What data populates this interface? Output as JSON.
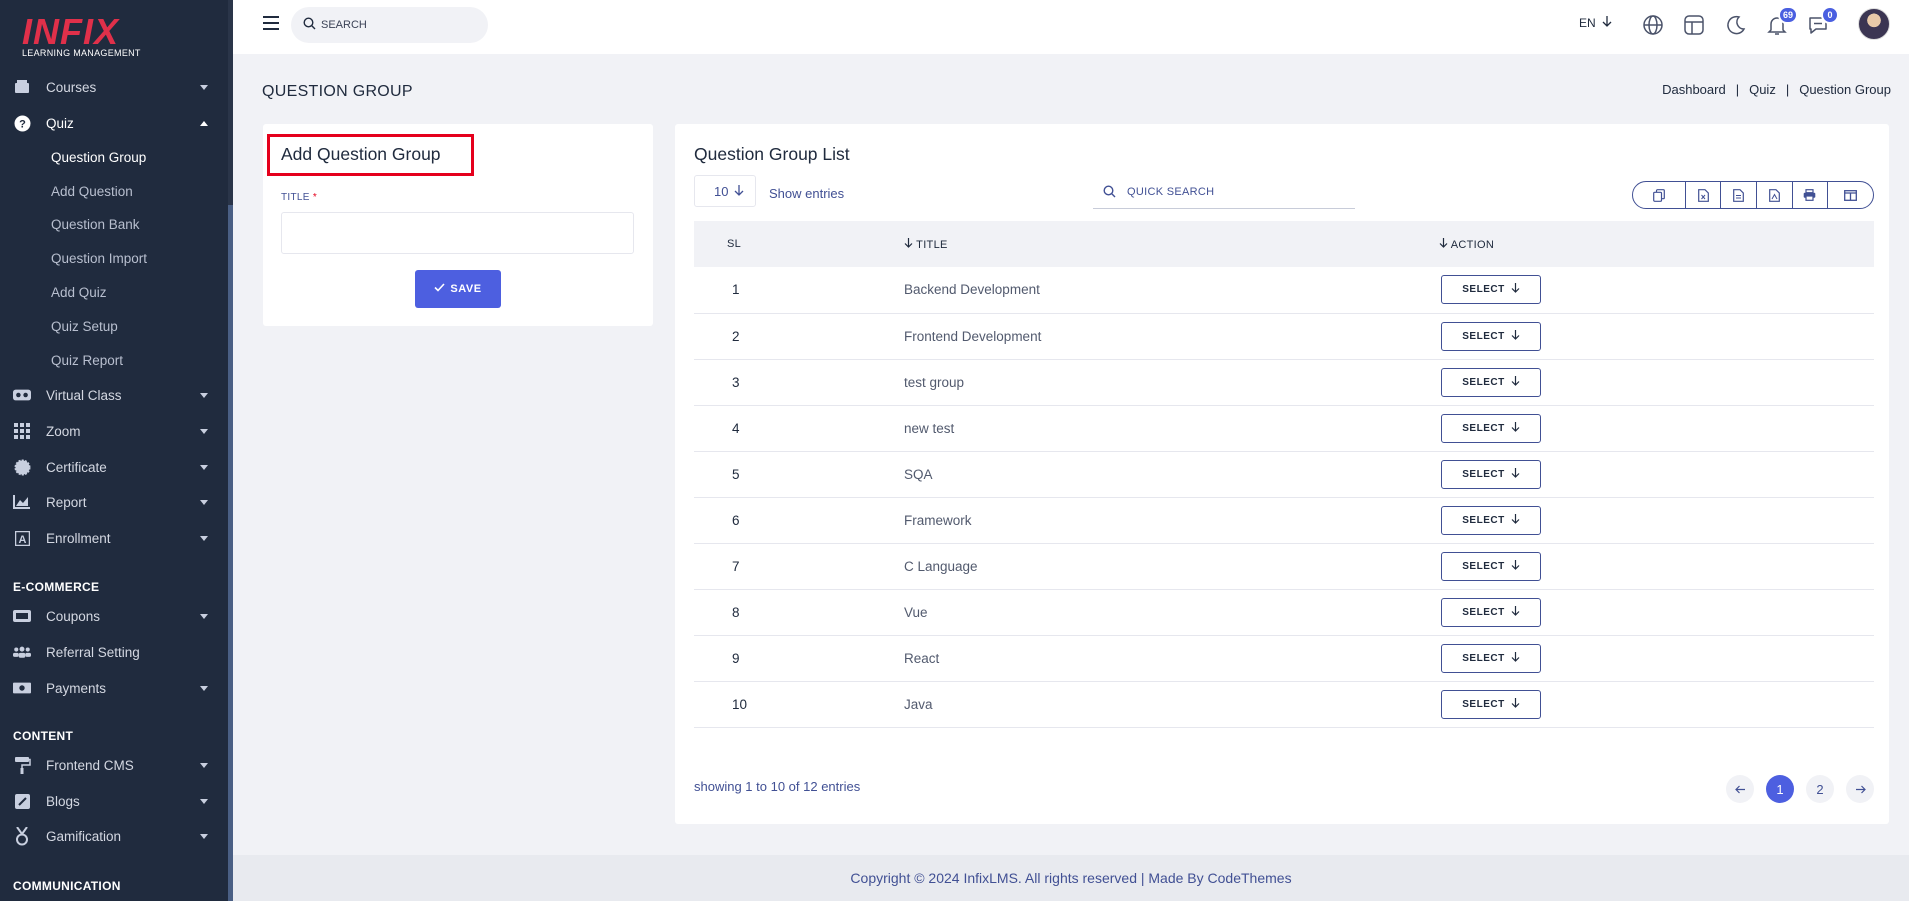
{
  "brand": {
    "name": "INFIX",
    "tagline": "LEARNING MANAGEMENT"
  },
  "sidebar": {
    "items": [
      {
        "label": "Courses",
        "icon": "book-icon"
      },
      {
        "label": "Quiz",
        "icon": "question-circle-icon"
      },
      {
        "label": "Virtual Class",
        "icon": "vr-icon"
      },
      {
        "label": "Zoom",
        "icon": "grid-icon"
      },
      {
        "label": "Certificate",
        "icon": "certificate-icon"
      },
      {
        "label": "Report",
        "icon": "chart-icon"
      },
      {
        "label": "Enrollment",
        "icon": "enrollment-icon"
      },
      {
        "label": "Coupons",
        "icon": "coupon-icon"
      },
      {
        "label": "Referral Setting",
        "icon": "users-icon"
      },
      {
        "label": "Payments",
        "icon": "money-icon"
      },
      {
        "label": "Frontend CMS",
        "icon": "paint-roller-icon"
      },
      {
        "label": "Blogs",
        "icon": "edit-icon"
      },
      {
        "label": "Gamification",
        "icon": "medal-icon"
      }
    ],
    "quiz_sub": [
      "Question Group",
      "Add Question",
      "Question Bank",
      "Question Import",
      "Add Quiz",
      "Quiz Setup",
      "Quiz Report"
    ],
    "sections": [
      "E-COMMERCE",
      "CONTENT",
      "COMMUNICATION"
    ]
  },
  "topbar": {
    "search_placeholder": "SEARCH",
    "language": "EN",
    "notification_count": "69",
    "message_count": "0"
  },
  "page": {
    "title": "QUESTION GROUP",
    "breadcrumb": [
      "Dashboard",
      "Quiz",
      "Question Group"
    ]
  },
  "add_form": {
    "title": "Add Question Group",
    "field_label": "TITLE",
    "required_mark": "*",
    "title_value": "",
    "save_label": "SAVE"
  },
  "list": {
    "title": "Question Group List",
    "entries_value": "10",
    "show_entries_label": "Show entries",
    "search_placeholder": "QUICK SEARCH",
    "columns": [
      "SL",
      "TITLE",
      "ACTION"
    ],
    "rows": [
      {
        "sl": "1",
        "title": "Backend Development"
      },
      {
        "sl": "2",
        "title": "Frontend Development"
      },
      {
        "sl": "3",
        "title": "test group"
      },
      {
        "sl": "4",
        "title": "new test"
      },
      {
        "sl": "5",
        "title": "SQA"
      },
      {
        "sl": "6",
        "title": "Framework"
      },
      {
        "sl": "7",
        "title": "C Language"
      },
      {
        "sl": "8",
        "title": "Vue"
      },
      {
        "sl": "9",
        "title": "React"
      },
      {
        "sl": "10",
        "title": "Java"
      }
    ],
    "select_label": "SELECT",
    "showing_text": "showing 1 to 10 of 12 entries",
    "pages": [
      "1",
      "2"
    ]
  },
  "footer": {
    "text": "Copyright © 2024 InfixLMS. All rights reserved | Made By CodeThemes"
  },
  "colors": {
    "accent": "#4d5fe0",
    "sidebar_bg": "#202b3e",
    "highlight": "#e5001c"
  }
}
